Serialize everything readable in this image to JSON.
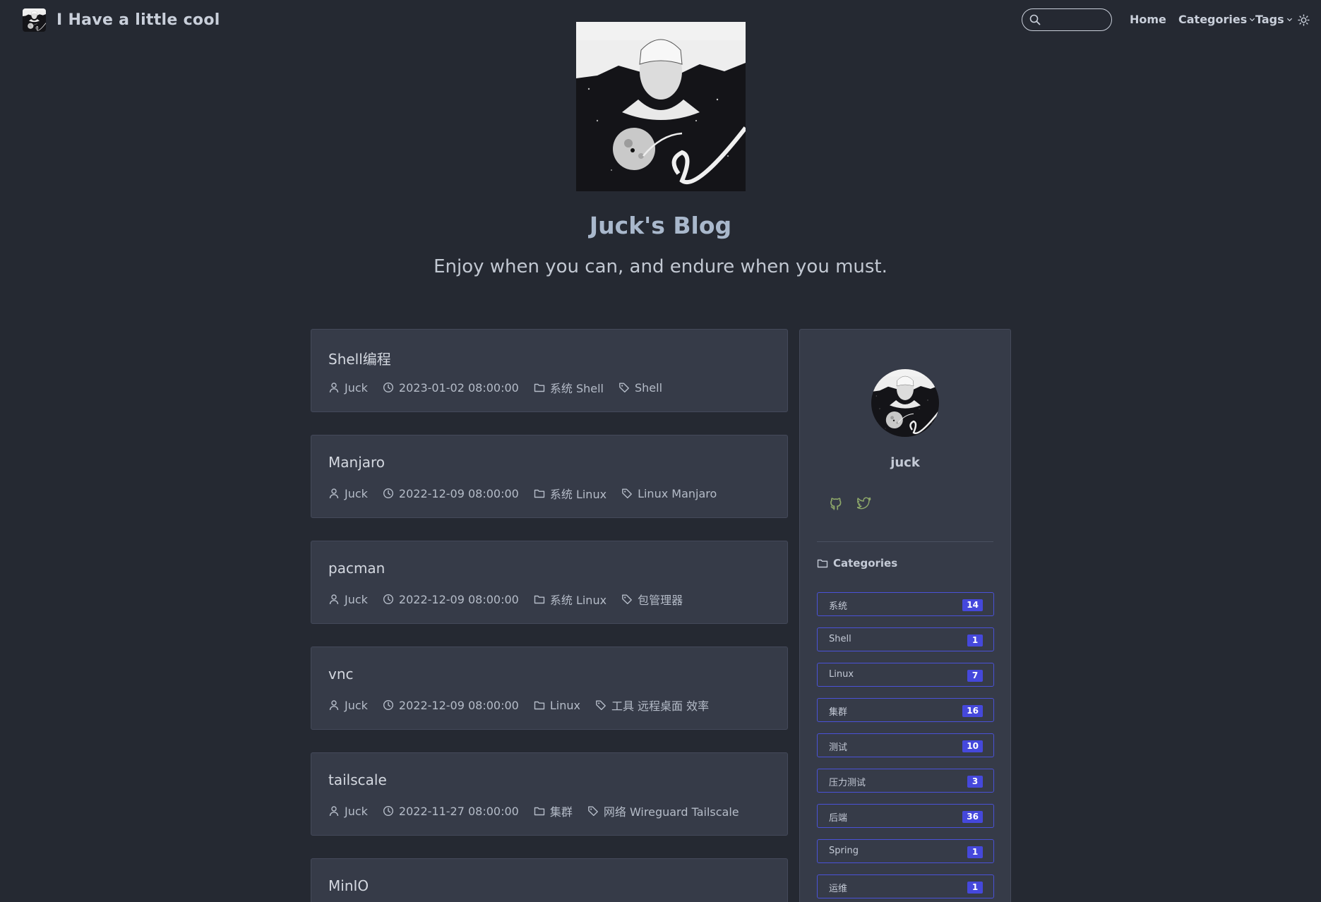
{
  "nav": {
    "brand_title": "I Have a little cool",
    "search_placeholder": "",
    "home_label": "Home",
    "categories_label": "Categories",
    "tags_label": "Tags"
  },
  "hero": {
    "title": "Juck's Blog",
    "subtitle": "Enjoy when you can, and endure when you must."
  },
  "posts": [
    {
      "title": "Shell编程",
      "author": "Juck",
      "date": "2023-01-02 08:00:00",
      "categories": "系统 Shell",
      "tags": "Shell"
    },
    {
      "title": "Manjaro",
      "author": "Juck",
      "date": "2022-12-09 08:00:00",
      "categories": "系统 Linux",
      "tags": "Linux Manjaro"
    },
    {
      "title": "pacman",
      "author": "Juck",
      "date": "2022-12-09 08:00:00",
      "categories": "系统 Linux",
      "tags": "包管理器"
    },
    {
      "title": "vnc",
      "author": "Juck",
      "date": "2022-12-09 08:00:00",
      "categories": "Linux",
      "tags": "工具 远程桌面 效率"
    },
    {
      "title": "tailscale",
      "author": "Juck",
      "date": "2022-11-27 08:00:00",
      "categories": "集群",
      "tags": "网络 Wireguard Tailscale"
    },
    {
      "title": "MinIO"
    }
  ],
  "sidebar": {
    "author_name": "juck",
    "categories_heading": "Categories",
    "categories": [
      {
        "label": "系统",
        "count": "14"
      },
      {
        "label": "Shell",
        "count": "1"
      },
      {
        "label": "Linux",
        "count": "7"
      },
      {
        "label": "集群",
        "count": "16"
      },
      {
        "label": "测试",
        "count": "10"
      },
      {
        "label": "压力测试",
        "count": "3"
      },
      {
        "label": "后端",
        "count": "36"
      },
      {
        "label": "Spring",
        "count": "1"
      },
      {
        "label": "运维",
        "count": "1"
      }
    ]
  },
  "icons": {
    "brand_logo": "avatar-artwork",
    "search": "search-icon",
    "theme_toggle": "sun-icon",
    "author": "user-icon",
    "date": "clock-icon",
    "category": "folder-icon",
    "tag": "tag-icon",
    "github": "github-icon",
    "twitter": "twitter-icon"
  },
  "colors": {
    "background": "#252932",
    "card": "#363b48",
    "accent": "#4548dc",
    "social": "#8ea86a"
  }
}
